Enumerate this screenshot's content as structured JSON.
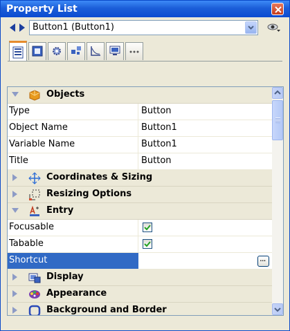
{
  "window": {
    "title": "Property List"
  },
  "object_selector": {
    "value": "Button1 (Button1)"
  },
  "tabs": [
    {
      "icon": "list-icon",
      "active": true
    },
    {
      "icon": "form-icon",
      "active": false
    },
    {
      "icon": "gear-icon",
      "active": false
    },
    {
      "icon": "blocks-icon",
      "active": false
    },
    {
      "icon": "graph-icon",
      "active": false
    },
    {
      "icon": "monitor-icon",
      "active": false
    },
    {
      "icon": "more-icon",
      "active": false
    }
  ],
  "categories": {
    "objects": "Objects",
    "coordinates": "Coordinates & Sizing",
    "resizing": "Resizing Options",
    "entry": "Entry",
    "display": "Display",
    "appearance": "Appearance",
    "background": "Background and Border"
  },
  "properties": {
    "type": {
      "label": "Type",
      "value": "Button"
    },
    "object_name": {
      "label": "Object Name",
      "value": "Button1"
    },
    "variable_name": {
      "label": "Variable Name",
      "value": "Button1"
    },
    "title": {
      "label": "Title",
      "value": "Button"
    },
    "focusable": {
      "label": "Focusable",
      "checked": true
    },
    "tabable": {
      "label": "Tabable",
      "checked": true
    },
    "shortcut": {
      "label": "Shortcut",
      "button": "..."
    }
  }
}
